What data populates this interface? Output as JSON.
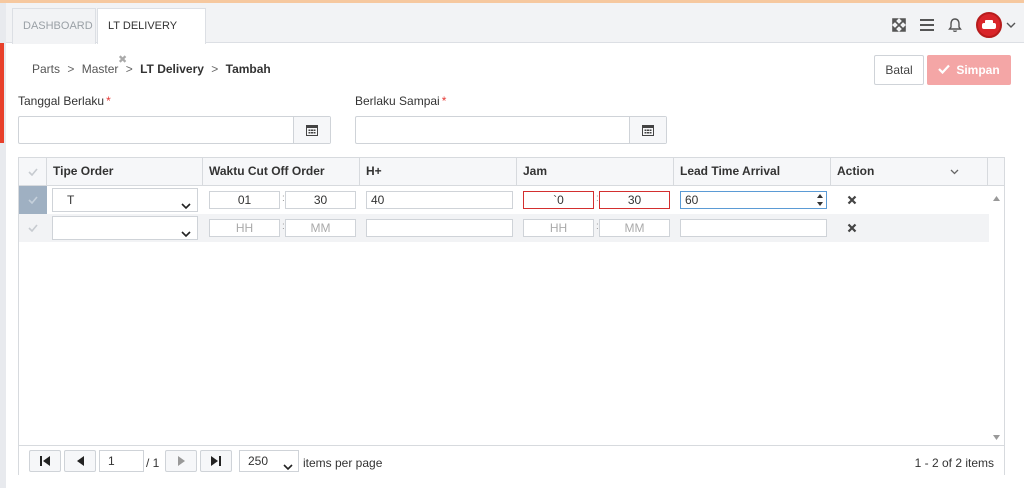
{
  "tabs": [
    {
      "label": "DASHBOARD"
    },
    {
      "label": "LT DELIVERY",
      "close": "✖"
    }
  ],
  "breadcrumb": [
    "Parts",
    "Master",
    "LT Delivery",
    "Tambah"
  ],
  "breadcrumb_sep": ">",
  "actions": {
    "batal": "Batal",
    "simpan": "Simpan"
  },
  "form": {
    "tanggal_berlaku": {
      "label": "Tanggal Berlaku",
      "required": "*"
    },
    "berlaku_sampai": {
      "label": "Berlaku Sampai",
      "required": "*"
    }
  },
  "grid": {
    "columns": [
      "Tipe Order",
      "Waktu Cut Off Order",
      "H+",
      "Jam",
      "Lead Time Arrival",
      "Action"
    ],
    "rows": [
      {
        "tipe_order": "T",
        "cut_hh": "01",
        "cut_mm": "30",
        "h_plus": "40",
        "jam_hh": "`0",
        "jam_mm": "30",
        "lead_time": "60"
      },
      {
        "tipe_order": "",
        "cut_hh": "HH",
        "cut_mm": "MM",
        "h_plus": "",
        "jam_hh": "HH",
        "jam_mm": "MM",
        "lead_time": ""
      }
    ],
    "colon": ":"
  },
  "pager": {
    "page": "1",
    "of_pages": "/ 1",
    "page_size": "250",
    "items_per_page": "items per page",
    "summary": "1 - 2 of 2 items"
  },
  "colors": {
    "accent": "#e8402a",
    "simpan": "#f4a6a6",
    "selected": "#9fb0c2"
  }
}
